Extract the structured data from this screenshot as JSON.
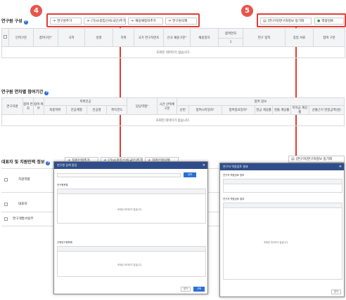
{
  "colors": {
    "accent": "#2b6fd6",
    "callout": "#e23d33",
    "popup_header": "#2f4d8a"
  },
  "callouts": {
    "four": "4",
    "five": "5"
  },
  "section1": {
    "title": "연구원 구성",
    "buttons": [
      {
        "label": "연구원추가",
        "icon": "arrow-right-icon"
      },
      {
        "label": "(가)소중입신서(국인)추가",
        "icon": "arrow-right-icon"
      },
      {
        "label": "재용예정자추가",
        "icon": "arrow-right-icon"
      },
      {
        "label": "연구원삭제",
        "icon": "arrow-right-icon"
      }
    ],
    "right_buttons": [
      {
        "label": "[연구자]연구자정보 동기화",
        "icon": "sync-icon"
      },
      {
        "label": "역량검토",
        "icon": "check-circle-icon"
      }
    ],
    "columns": [
      "",
      "인력구분",
      "참여구분",
      "국적",
      "성명",
      "직위",
      "국가 연구자번호",
      "신규 채용구분",
      "채용일자",
      "참여연차",
      "연구 업적",
      "증빙 서류",
      "참여 구분"
    ],
    "sub_value": "1",
    "empty_text": "조회된 데이터가 없습니다."
  },
  "section2": {
    "title": "연구원 연차별 참여기간",
    "columns_top": [
      "연구자명",
      "참여 연차",
      "참여 여부",
      "학위전공",
      "담당역할",
      "시간 산택체 구분",
      "참여 정보"
    ],
    "columns_degree": [
      "최종학위",
      "전공계열",
      "전공명",
      "취득연도"
    ],
    "columns_info": [
      "순번",
      "참여시작일자",
      "참여종료일자",
      "현금 계상률",
      "현물 계상률",
      "미지급 계상률",
      "산출근거 연봉금액(원)"
    ],
    "empty_text": "조회된 데이터가 없습니다."
  },
  "section3": {
    "title": "대표자 및 지원인력 정보",
    "buttons": [
      {
        "label": "지원인력추가",
        "icon": "arrow-right-icon"
      },
      {
        "label": "(가)소중입신서(국인)추가",
        "icon": "arrow-right-icon"
      },
      {
        "label": "지원인력삭제",
        "icon": "arrow-right-icon"
      }
    ],
    "right_button": {
      "label": "[연구자]연구자정보 동기화",
      "icon": "sync-icon"
    },
    "columns": [
      "",
      "지원역할"
    ],
    "rows": [
      "대표자",
      "연구개발서실무"
    ]
  },
  "popup_left": {
    "title": "연구원 검색 팝업",
    "search_btn": "검색",
    "section_a": "연구원목록",
    "section_b": "선택연구원목록",
    "empty_text": "조회된 데이터가 없습니다.",
    "footer_buttons": [
      "닫기",
      "선택"
    ]
  },
  "popup_right": {
    "title": "연구자 역량검토 결과",
    "section_a": "연구자 역량검토 정보",
    "section_b": "연구자 역량검토 결과",
    "empty_text": "조회된 데이터가 없습니다.",
    "footer_button": "닫기"
  }
}
